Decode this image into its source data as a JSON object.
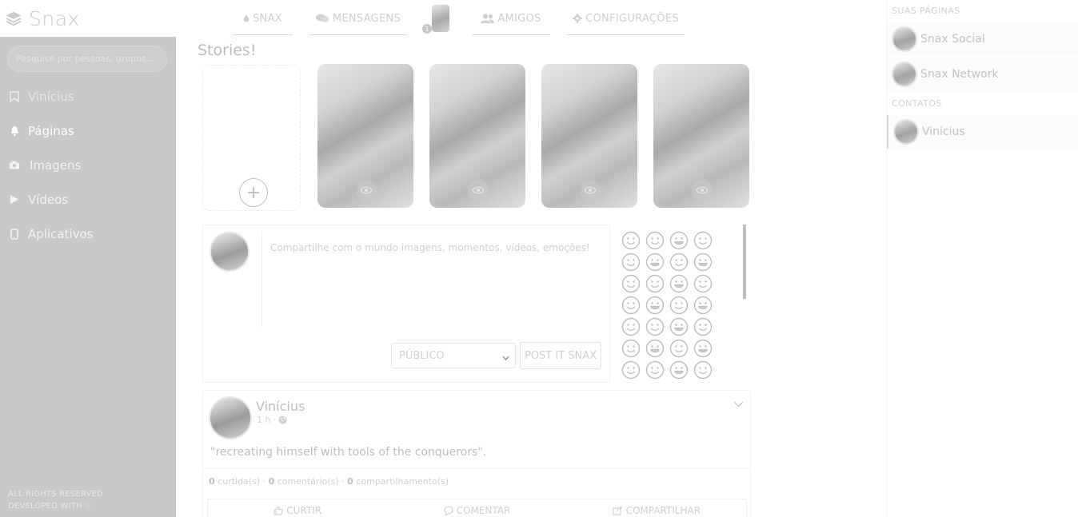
{
  "brand": {
    "name": "Snax"
  },
  "sidebar": {
    "search_placeholder": "Pesquise por pessoas, grupos...",
    "items": [
      {
        "label": "Vinícius",
        "icon": "bookmark-icon"
      },
      {
        "label": "Páginas",
        "icon": "bell-icon"
      },
      {
        "label": "Imagens",
        "icon": "camera-icon"
      },
      {
        "label": "Vídeos",
        "icon": "play-icon"
      },
      {
        "label": "Aplicativos",
        "icon": "mobile-icon"
      }
    ],
    "footer_line1": "ALL RIGHTS RESERVED",
    "footer_line2": "DEVELOPED WITH ♡"
  },
  "topnav": {
    "tabs": [
      {
        "label": "SNAX",
        "icon": "drop-icon"
      },
      {
        "label": "MENSAGENS",
        "icon": "chat-icon"
      },
      {
        "label": "AMIGOS",
        "icon": "users-icon"
      },
      {
        "label": "CONFIGURAÇÕES",
        "icon": "gear-icon"
      }
    ],
    "notification_count": "1"
  },
  "stories": {
    "title": "Stories!",
    "add_symbol": "+",
    "count": 4
  },
  "composer": {
    "placeholder": "Compartilhe com o mundo imagens, momentos, vídeos, emoções!",
    "visibility": "PÚBLICO",
    "post_label": "POST IT SNAX"
  },
  "post": {
    "author": "Vinícius",
    "time": "1 h ·",
    "text": "\"recreating himself with tools of the conquerors\".",
    "likes": "0",
    "likes_label": "curtida(s) ·",
    "comments": "0",
    "comments_label": "comentário(s) ·",
    "shares": "0",
    "shares_label": "compartilhamento(s)",
    "like_label": "CURTIR",
    "comment_label": "COMENTAR",
    "share_label": "COMPARTILHAR"
  },
  "rightpanel": {
    "pages_heading": "SUAS PÁGINAS",
    "pages": [
      "Snax Social",
      "Snax Network"
    ],
    "contacts_heading": "CONTATOS",
    "contacts": [
      "Vinícius"
    ]
  },
  "colors": {
    "sidebar_bg": "#c8c8c8",
    "text_muted": "#cfcfcf"
  }
}
